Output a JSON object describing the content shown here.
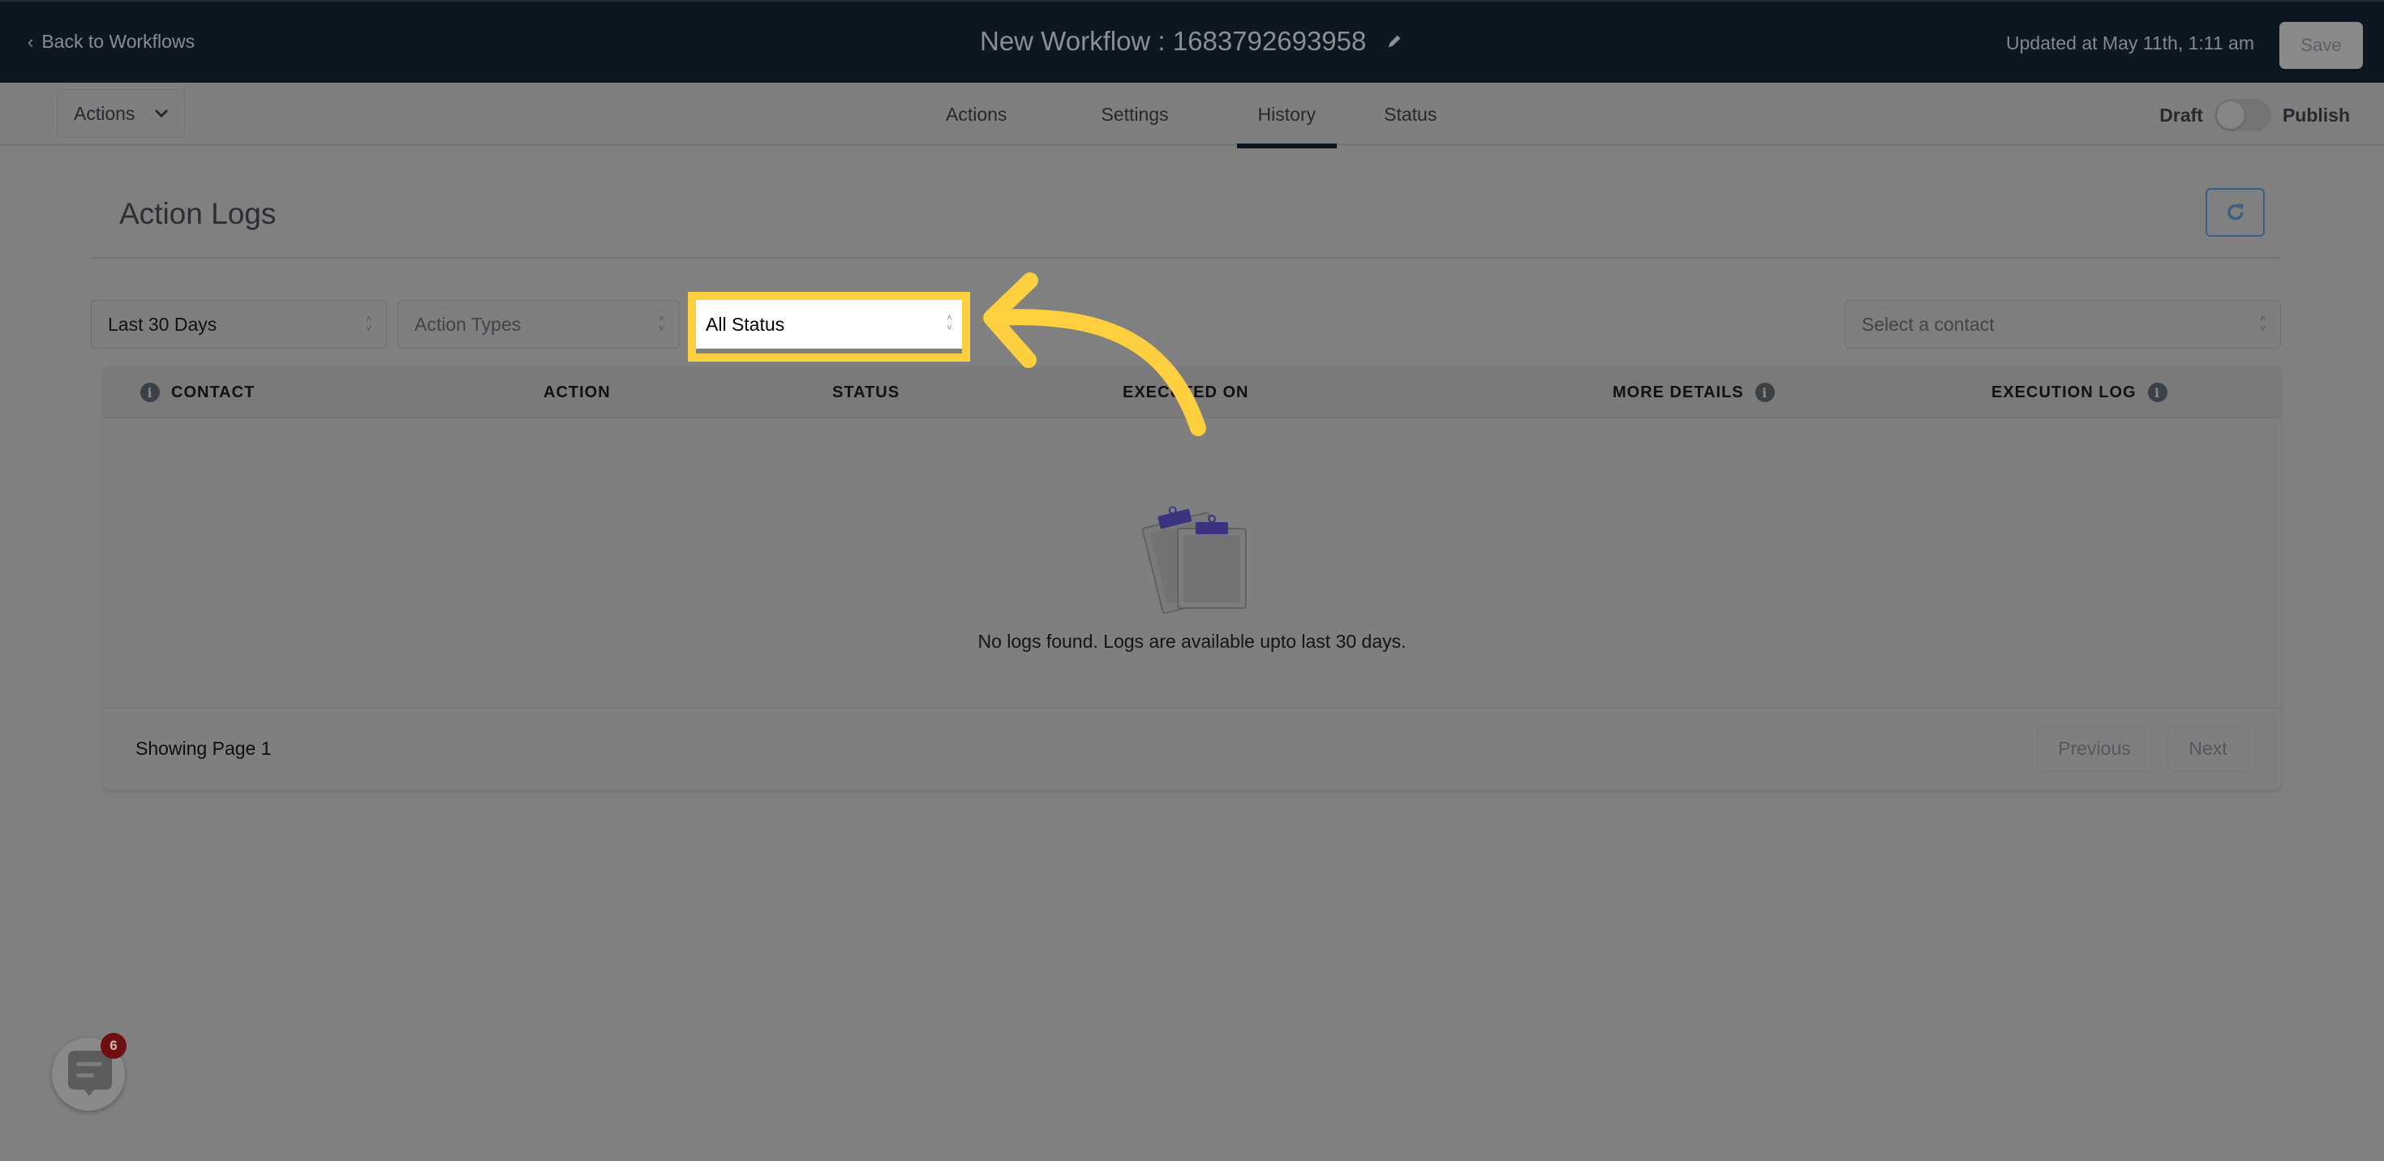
{
  "header": {
    "back_label": "Back to Workflows",
    "workflow_title": "New Workflow : 1683792693958",
    "updated_text": "Updated at May 11th, 1:11 am",
    "save_label": "Save"
  },
  "subnav": {
    "actions_dropdown_label": "Actions",
    "tabs": [
      {
        "label": "Actions",
        "active": false
      },
      {
        "label": "Settings",
        "active": false
      },
      {
        "label": "History",
        "active": true
      },
      {
        "label": "Status",
        "active": false
      }
    ],
    "toggle": {
      "left_label": "Draft",
      "right_label": "Publish",
      "published": false
    }
  },
  "main": {
    "title": "Action Logs",
    "filters": {
      "date_range": "Last 30 Days",
      "action_types_placeholder": "Action Types",
      "status": "All Status",
      "contact_placeholder": "Select a contact"
    },
    "table": {
      "columns": [
        {
          "label": "CONTACT",
          "info": true
        },
        {
          "label": "ACTION",
          "info": false
        },
        {
          "label": "STATUS",
          "info": false
        },
        {
          "label": "EXECUTED ON",
          "info": false
        },
        {
          "label": "MORE DETAILS",
          "info": true
        },
        {
          "label": "EXECUTION LOG",
          "info": true
        }
      ],
      "empty_message": "No logs found. Logs are available upto last 30 days.",
      "footer": {
        "showing": "Showing Page 1",
        "previous_label": "Previous",
        "next_label": "Next"
      }
    }
  },
  "chat_widget": {
    "badge_count": "6"
  },
  "colors": {
    "header_bg": "#0d1721",
    "highlight": "#fecf3e",
    "refresh_accent": "#3b5f84",
    "clip_accent": "#3a3480",
    "badge": "#6e0f12"
  }
}
